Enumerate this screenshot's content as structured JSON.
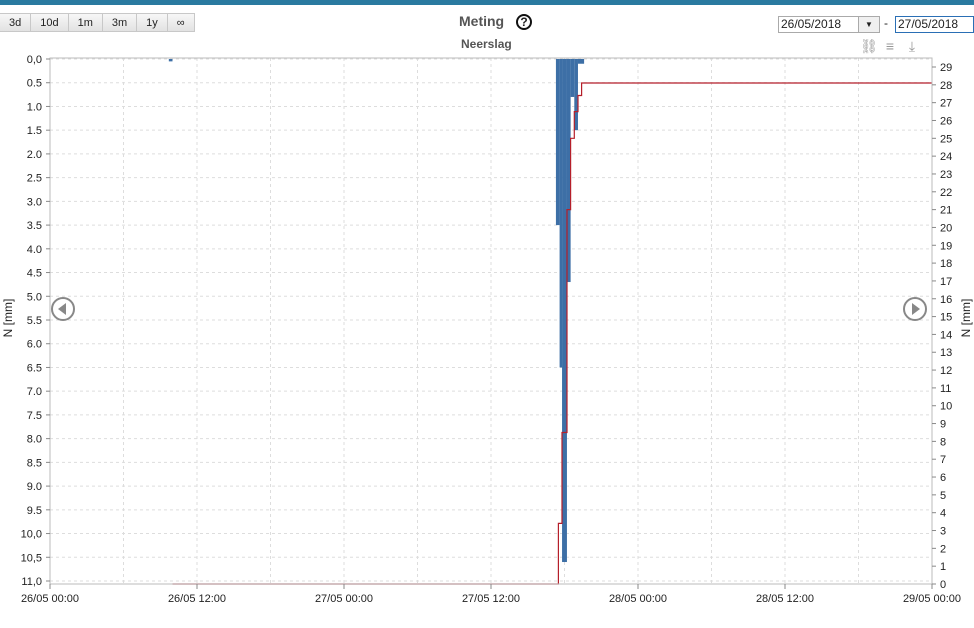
{
  "header": {
    "range_buttons": [
      "3d",
      "10d",
      "1m",
      "3m",
      "1y",
      "∞"
    ],
    "title": "Meting",
    "help": "?",
    "subtitle": "Neerslag",
    "date_from": "26/05/2018",
    "date_sep": "-",
    "date_to": "27/05/2018",
    "tool_icons": [
      "link-icon",
      "list-icon",
      "download-icon"
    ]
  },
  "chart_data": {
    "type": "bar",
    "title": "Neerslag",
    "ylabel_left": "N [mm]",
    "ylabel_right": "N [mm]",
    "left_axis": {
      "min": 0,
      "max": 11,
      "inverted": true,
      "ticks": [
        "0,0",
        "0.5",
        "1.0",
        "1.5",
        "2.0",
        "2.5",
        "3.0",
        "3.5",
        "4.0",
        "4.5",
        "5.0",
        "5.5",
        "6.0",
        "6.5",
        "7.0",
        "7.5",
        "8.0",
        "8.5",
        "9.0",
        "9.5",
        "10,0",
        "10,5",
        "11,0"
      ]
    },
    "right_axis": {
      "min": 0,
      "max": 29.5,
      "ticks": [
        "0",
        "1",
        "2",
        "3",
        "4",
        "5",
        "6",
        "7",
        "8",
        "9",
        "10",
        "11",
        "12",
        "13",
        "14",
        "15",
        "16",
        "17",
        "18",
        "19",
        "20",
        "21",
        "22",
        "23",
        "24",
        "25",
        "26",
        "27",
        "28",
        "29"
      ]
    },
    "x_axis": {
      "start_hours": 0,
      "end_hours": 72,
      "ticks": [
        "26/05 00:00",
        "26/05 12:00",
        "27/05 00:00",
        "27/05 12:00",
        "28/05 00:00",
        "28/05 12:00",
        "29/05 00:00"
      ]
    },
    "grid": true,
    "series": [
      {
        "kind": "bars",
        "color": "#3d6fa6",
        "bars": [
          {
            "t0": 9.7,
            "t1": 10.0,
            "value": 0.05
          },
          {
            "t0": 41.3,
            "t1": 41.6,
            "value": 3.5
          },
          {
            "t0": 41.6,
            "t1": 41.8,
            "value": 6.5
          },
          {
            "t0": 41.8,
            "t1": 42.2,
            "value": 10.6
          },
          {
            "t0": 42.2,
            "t1": 42.5,
            "value": 4.7
          },
          {
            "t0": 42.5,
            "t1": 42.8,
            "value": 0.8
          },
          {
            "t0": 42.8,
            "t1": 43.1,
            "value": 1.5
          },
          {
            "t0": 43.1,
            "t1": 43.6,
            "value": 0.1
          }
        ]
      },
      {
        "kind": "step-line",
        "color": "#b51f2a",
        "points": [
          [
            10.0,
            0.0
          ],
          [
            41.5,
            0.0
          ],
          [
            41.5,
            3.4
          ],
          [
            41.8,
            3.4
          ],
          [
            41.8,
            8.5
          ],
          [
            42.2,
            8.5
          ],
          [
            42.2,
            21.0
          ],
          [
            42.5,
            21.0
          ],
          [
            42.5,
            25.0
          ],
          [
            42.8,
            25.0
          ],
          [
            42.8,
            26.5
          ],
          [
            43.1,
            26.5
          ],
          [
            43.1,
            27.4
          ],
          [
            43.4,
            27.4
          ],
          [
            43.4,
            28.1
          ],
          [
            72.0,
            28.1
          ]
        ]
      }
    ]
  }
}
